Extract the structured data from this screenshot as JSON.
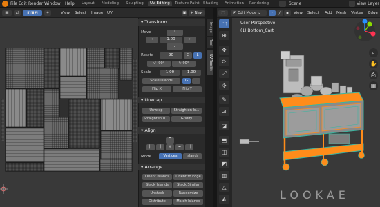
{
  "topbar": {
    "menus": [
      "File",
      "Edit",
      "Render",
      "Window",
      "Help"
    ],
    "workspaces": [
      "Layout",
      "Modeling",
      "Sculpting",
      "UV Editing",
      "Texture Paint",
      "Shading",
      "Animation",
      "Rendering"
    ],
    "active_workspace": "UV Editing",
    "scene": "Scene",
    "view_layer": "View Layer"
  },
  "uv_header": {
    "menus": [
      "View",
      "Select",
      "Image",
      "UV"
    ],
    "new_button": "New"
  },
  "npanel": {
    "transform": {
      "title": "Transform",
      "move_label": "Move",
      "move_value": "1.00",
      "rotate_label": "Rotate",
      "rotate_value": "90",
      "g_label": "G",
      "l_label": "L",
      "rot_minus": "-90°",
      "rot_plus": "90°",
      "scale_label": "Scale",
      "scale_x": "1.00",
      "scale_y": "1.00",
      "scale_islands": "Scale Islands",
      "flip_x": "Flip X",
      "flip_y": "Flip Y"
    },
    "unwrap": {
      "title": "Unwrap",
      "unwrap_btn": "Unwrap",
      "straighten_is": "Straighten Is...",
      "straighten_u": "Straighten U...",
      "gridify": "Gridify"
    },
    "align": {
      "title": "Align",
      "mode_label": "Mode",
      "vertices": "Vertices",
      "islands": "Islands"
    },
    "arrange": {
      "title": "Arrange",
      "orient_islands": "Orient Islands",
      "orient_to_edge": "Orient to Edge",
      "stack_islands": "Stack Islands",
      "stack_similar": "Stack Similar",
      "unstack": "Unstack",
      "randomize": "Randomize",
      "distribute": "Distribute",
      "match_islands": "Match Islands"
    }
  },
  "side_tabs": [
    "Image",
    "Tool",
    "UV Toolkit"
  ],
  "viewport": {
    "mode": "Edit Mode",
    "menus": [
      "View",
      "Select",
      "Add",
      "Mesh",
      "Vertex",
      "Edge"
    ],
    "view_name": "User Perspective",
    "object_name": "(1) Bottom_Cart"
  },
  "watermark": "LOOKAE",
  "colors": {
    "accent": "#4772b3",
    "selection": "#ff8c1a",
    "teal_edges": "#3cb4a0"
  }
}
